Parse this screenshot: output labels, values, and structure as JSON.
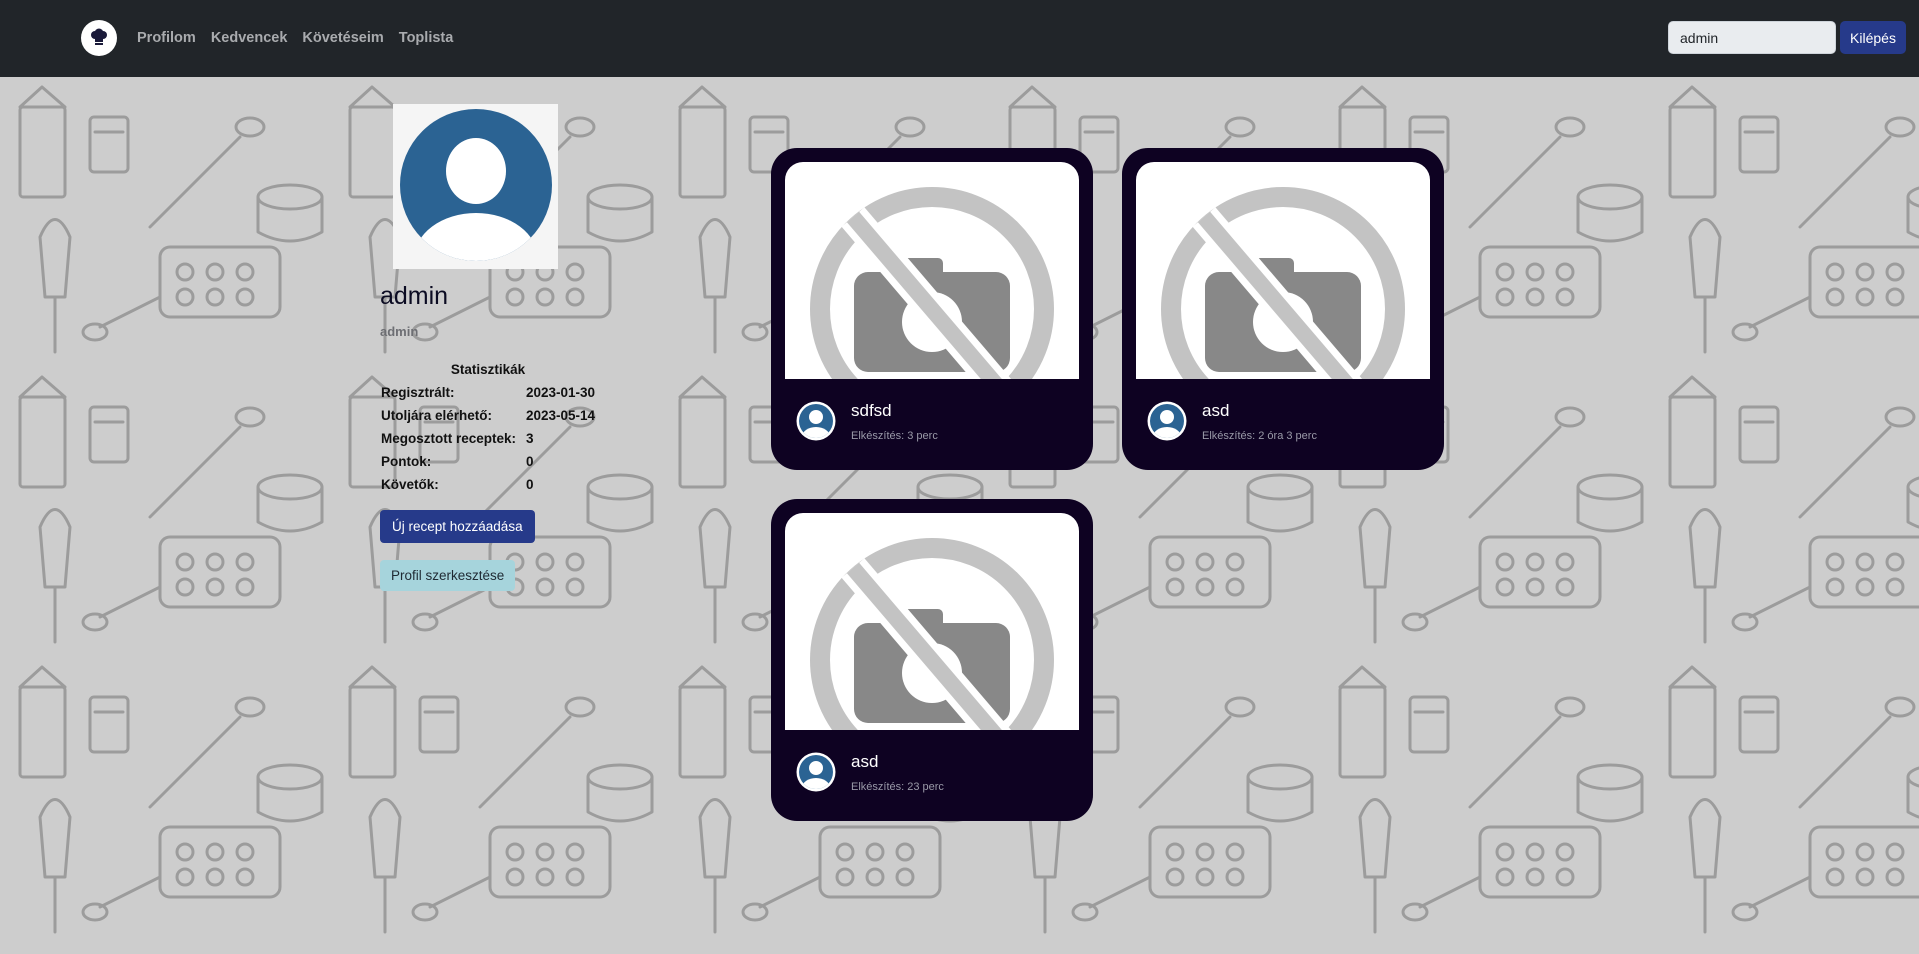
{
  "nav": {
    "links": [
      "Profilom",
      "Kedvencek",
      "Követéseim",
      "Toplista"
    ],
    "search_value": "admin",
    "logout_label": "Kilépés"
  },
  "profile": {
    "username": "admin",
    "role": "admin",
    "stats_title": "Statisztikák",
    "stats": [
      {
        "label": "Regisztrált:",
        "value": "2023-01-30"
      },
      {
        "label": "Utoljára elérhető:",
        "value": "2023-05-14"
      },
      {
        "label": "Megosztott receptek:",
        "value": "3"
      },
      {
        "label": "Pontok:",
        "value": "0"
      },
      {
        "label": "Követők:",
        "value": "0"
      }
    ],
    "add_recipe_label": "Új recept hozzáadása",
    "edit_profile_label": "Profil szerkesztése"
  },
  "recipes": [
    {
      "title": "sdfsd",
      "time": "Elkészítés: 3 perc"
    },
    {
      "title": "asd",
      "time": "Elkészítés: 2 óra 3 perc"
    },
    {
      "title": "asd",
      "time": "Elkészítés: 23 perc"
    }
  ],
  "colors": {
    "navbar": "#212529",
    "primary": "#263a8a",
    "card": "#0e0222",
    "info": "#a6d4dc",
    "avatar": "#2b6393"
  }
}
